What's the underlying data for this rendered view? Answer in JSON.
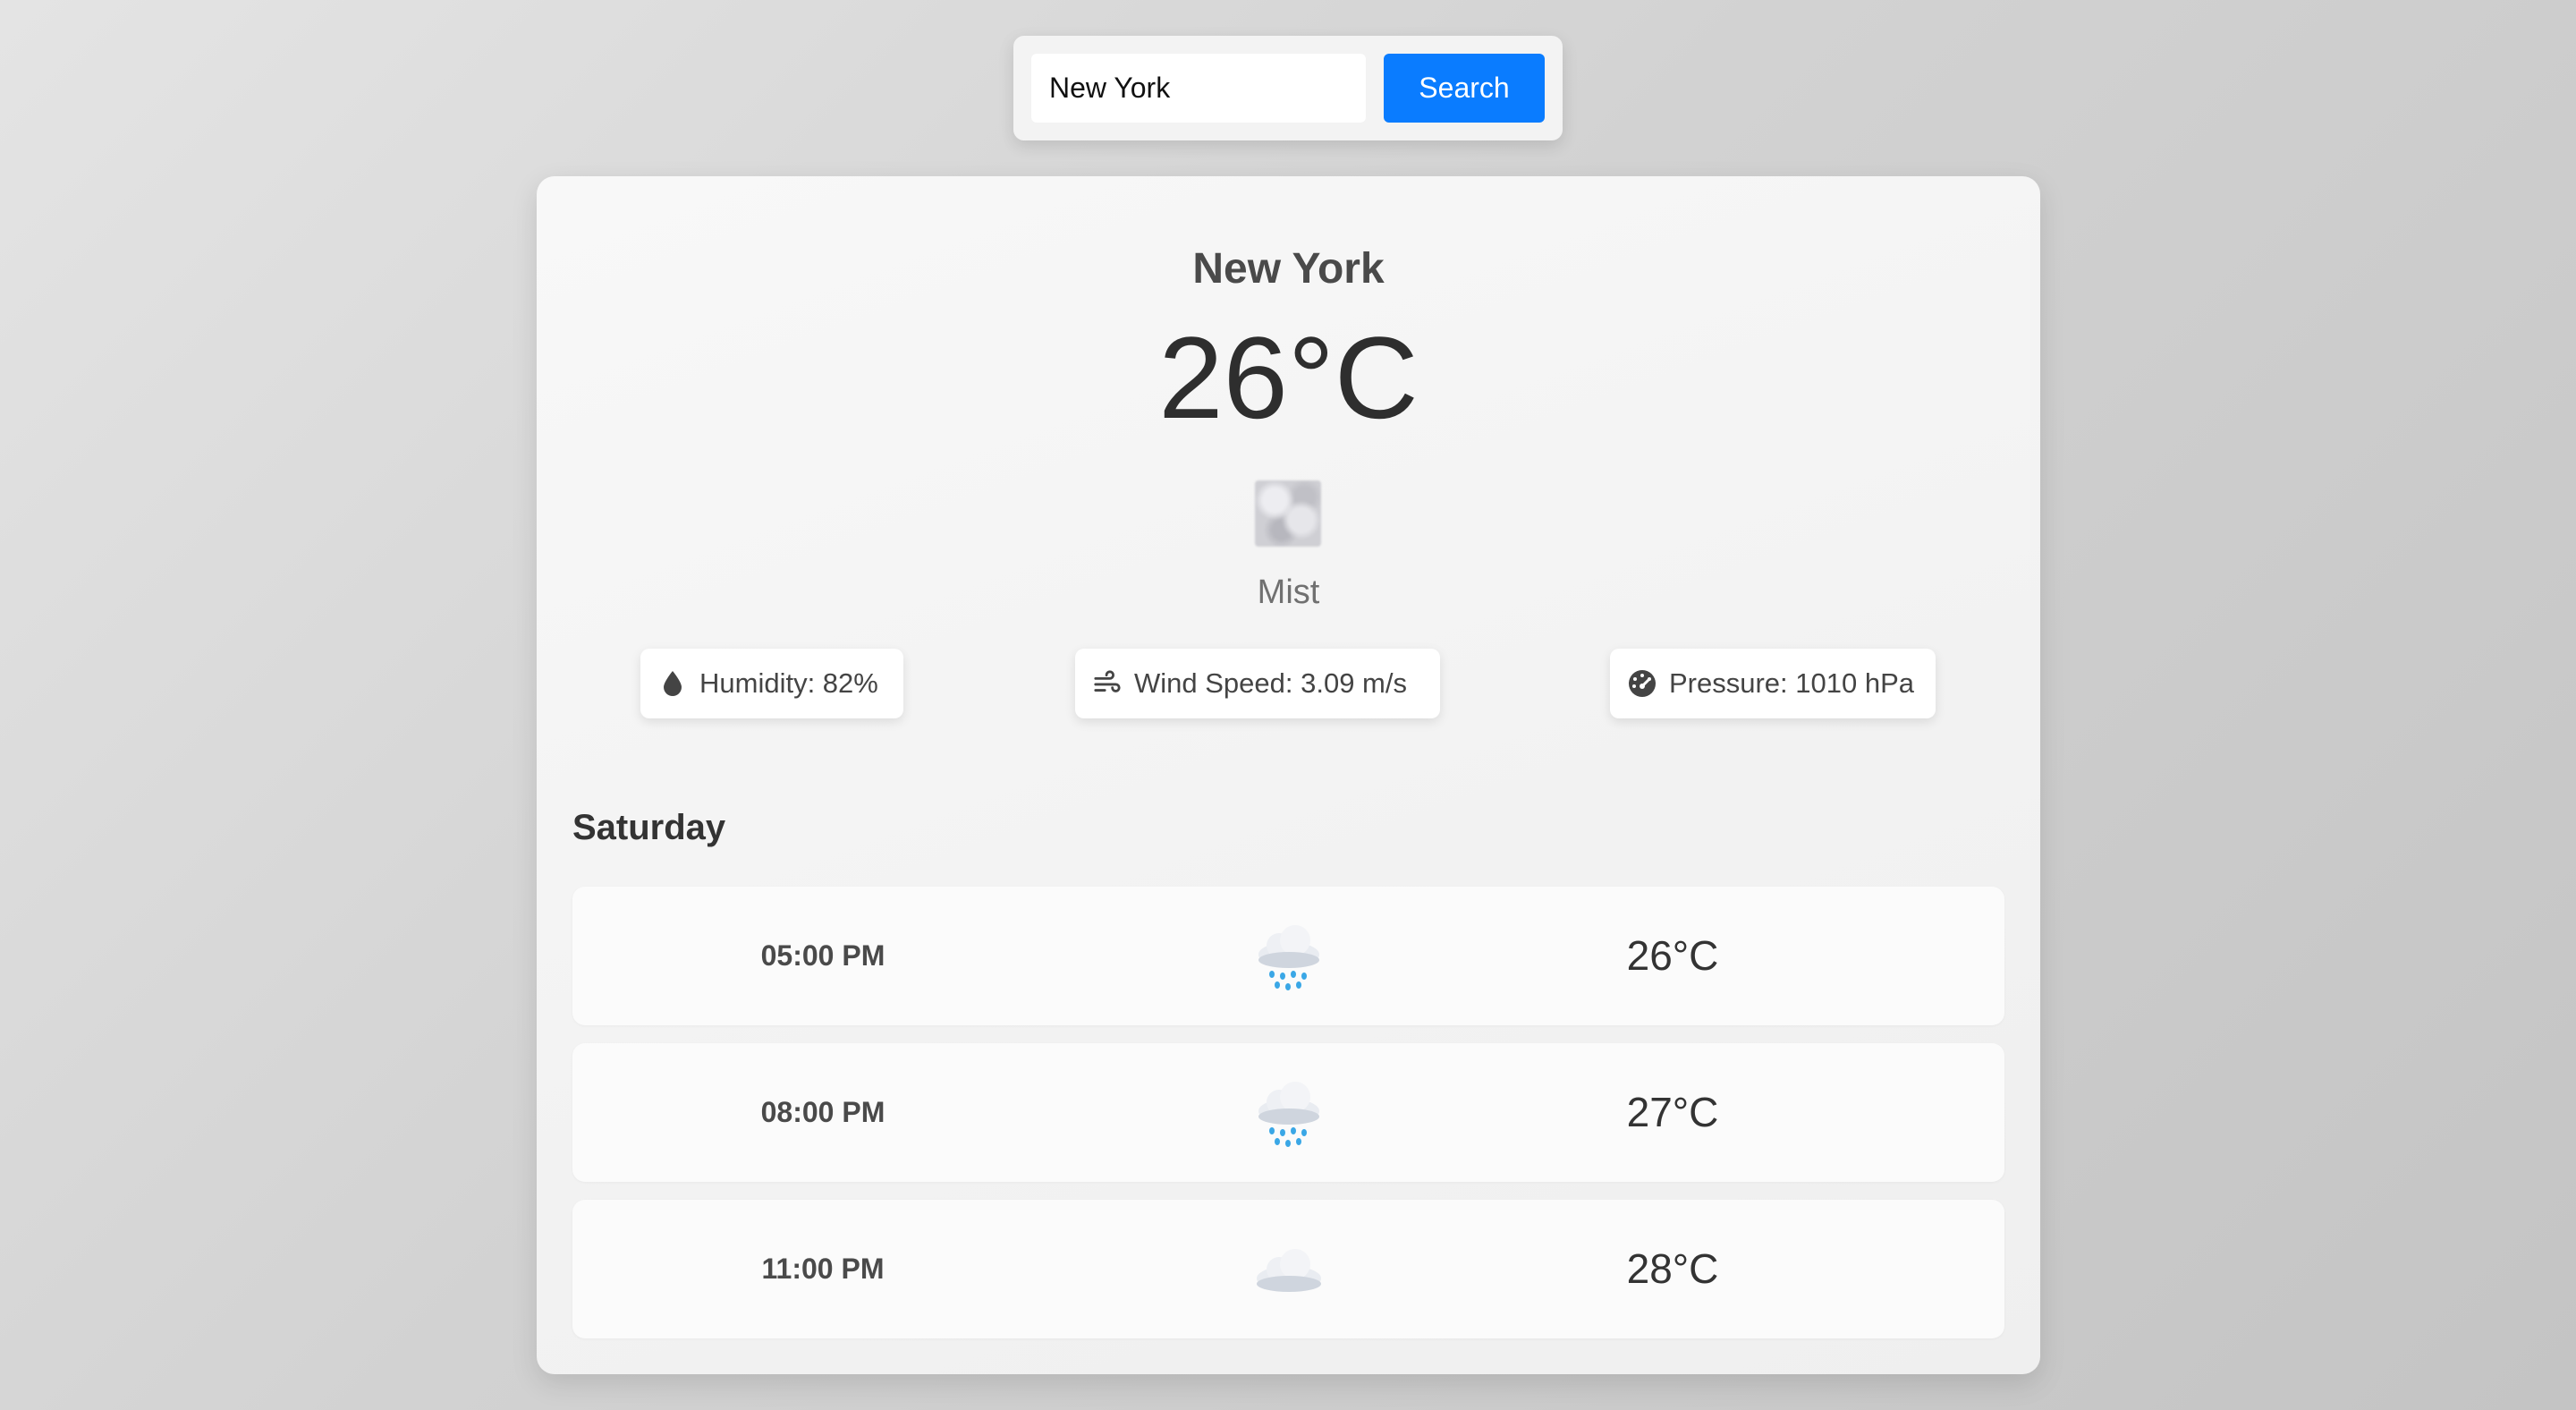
{
  "search": {
    "value": "New York",
    "button_label": "Search"
  },
  "current": {
    "city": "New York",
    "temperature": "26°C",
    "description": "Mist",
    "icon": "mist-image"
  },
  "stats": {
    "humidity": {
      "label": "Humidity: 82%",
      "icon": "droplet-icon"
    },
    "wind": {
      "label": "Wind Speed: 3.09 m/s",
      "icon": "wind-icon"
    },
    "pressure": {
      "label": "Pressure: 1010 hPa",
      "icon": "gauge-icon"
    }
  },
  "forecast": {
    "day": "Saturday",
    "items": [
      {
        "time": "05:00 PM",
        "icon": "rain-cloud-icon",
        "temp": "26°C"
      },
      {
        "time": "08:00 PM",
        "icon": "rain-cloud-icon",
        "temp": "27°C"
      },
      {
        "time": "11:00 PM",
        "icon": "cloud-icon",
        "temp": "28°C"
      }
    ]
  },
  "colors": {
    "accent": "#0a7cff",
    "text_dark": "#2e2e2e",
    "text_muted": "#707070"
  }
}
